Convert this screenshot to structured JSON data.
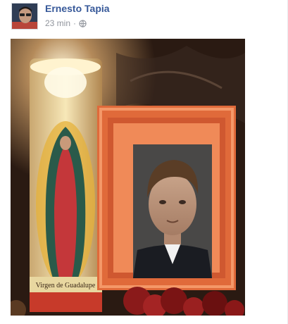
{
  "post": {
    "author_name": "Ernesto Tapia",
    "timestamp": "23 min",
    "separator": "·",
    "audience_icon": "globe-icon",
    "avatar_icon": "profile-photo",
    "photo": {
      "description_icon": "candle-and-framed-portrait-photo",
      "candle_label": "Virgen de Guadalupe"
    }
  },
  "colors": {
    "author_link": "#365899",
    "meta_text": "#90949c"
  }
}
